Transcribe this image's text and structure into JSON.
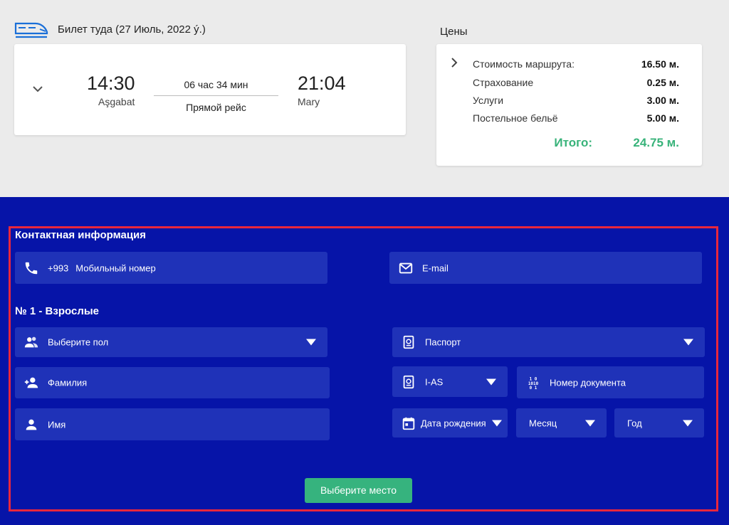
{
  "ticket": {
    "title": "Билет туда (27 Июль, 2022 ý.)",
    "departure_time": "14:30",
    "departure_city": "Aşgabat",
    "duration": "06 час 34 мин",
    "route_type": "Прямой рейс",
    "arrival_time": "21:04",
    "arrival_city": "Mary",
    "icon": "train-icon"
  },
  "prices": {
    "title": "Цены",
    "rows": [
      {
        "label": "Стоимость маршрута:",
        "amount": "16.50 м."
      },
      {
        "label": "Страхование",
        "amount": "0.25 м."
      },
      {
        "label": "Услуги",
        "amount": "3.00 м."
      },
      {
        "label": "Постельное бельё",
        "amount": "5.00 м."
      }
    ],
    "total_label": "Итого:",
    "total_amount": "24.75 м."
  },
  "contact": {
    "title": "Контактная информация",
    "phone_prefix": "+993",
    "phone_placeholder": "Мобильный номер",
    "email_placeholder": "E-mail"
  },
  "passenger": {
    "title": "№ 1 - Взрослые",
    "gender": "Выберите пол",
    "surname": "Фамилия",
    "name": "Имя",
    "document_type": "Паспорт",
    "document_series": "I-AS",
    "document_number": "Номер документа",
    "birth_date": "Дата рождения",
    "month": "Месяц",
    "year": "Год"
  },
  "actions": {
    "choose_seat": "Выберите место"
  },
  "colors": {
    "page_bg": "#ebebeb",
    "form_bg": "#0614a8",
    "field_bg": "#1f32b8",
    "accent_green": "#36b37e",
    "frame_red": "#e8273c",
    "train_blue": "#1a6fd8"
  }
}
